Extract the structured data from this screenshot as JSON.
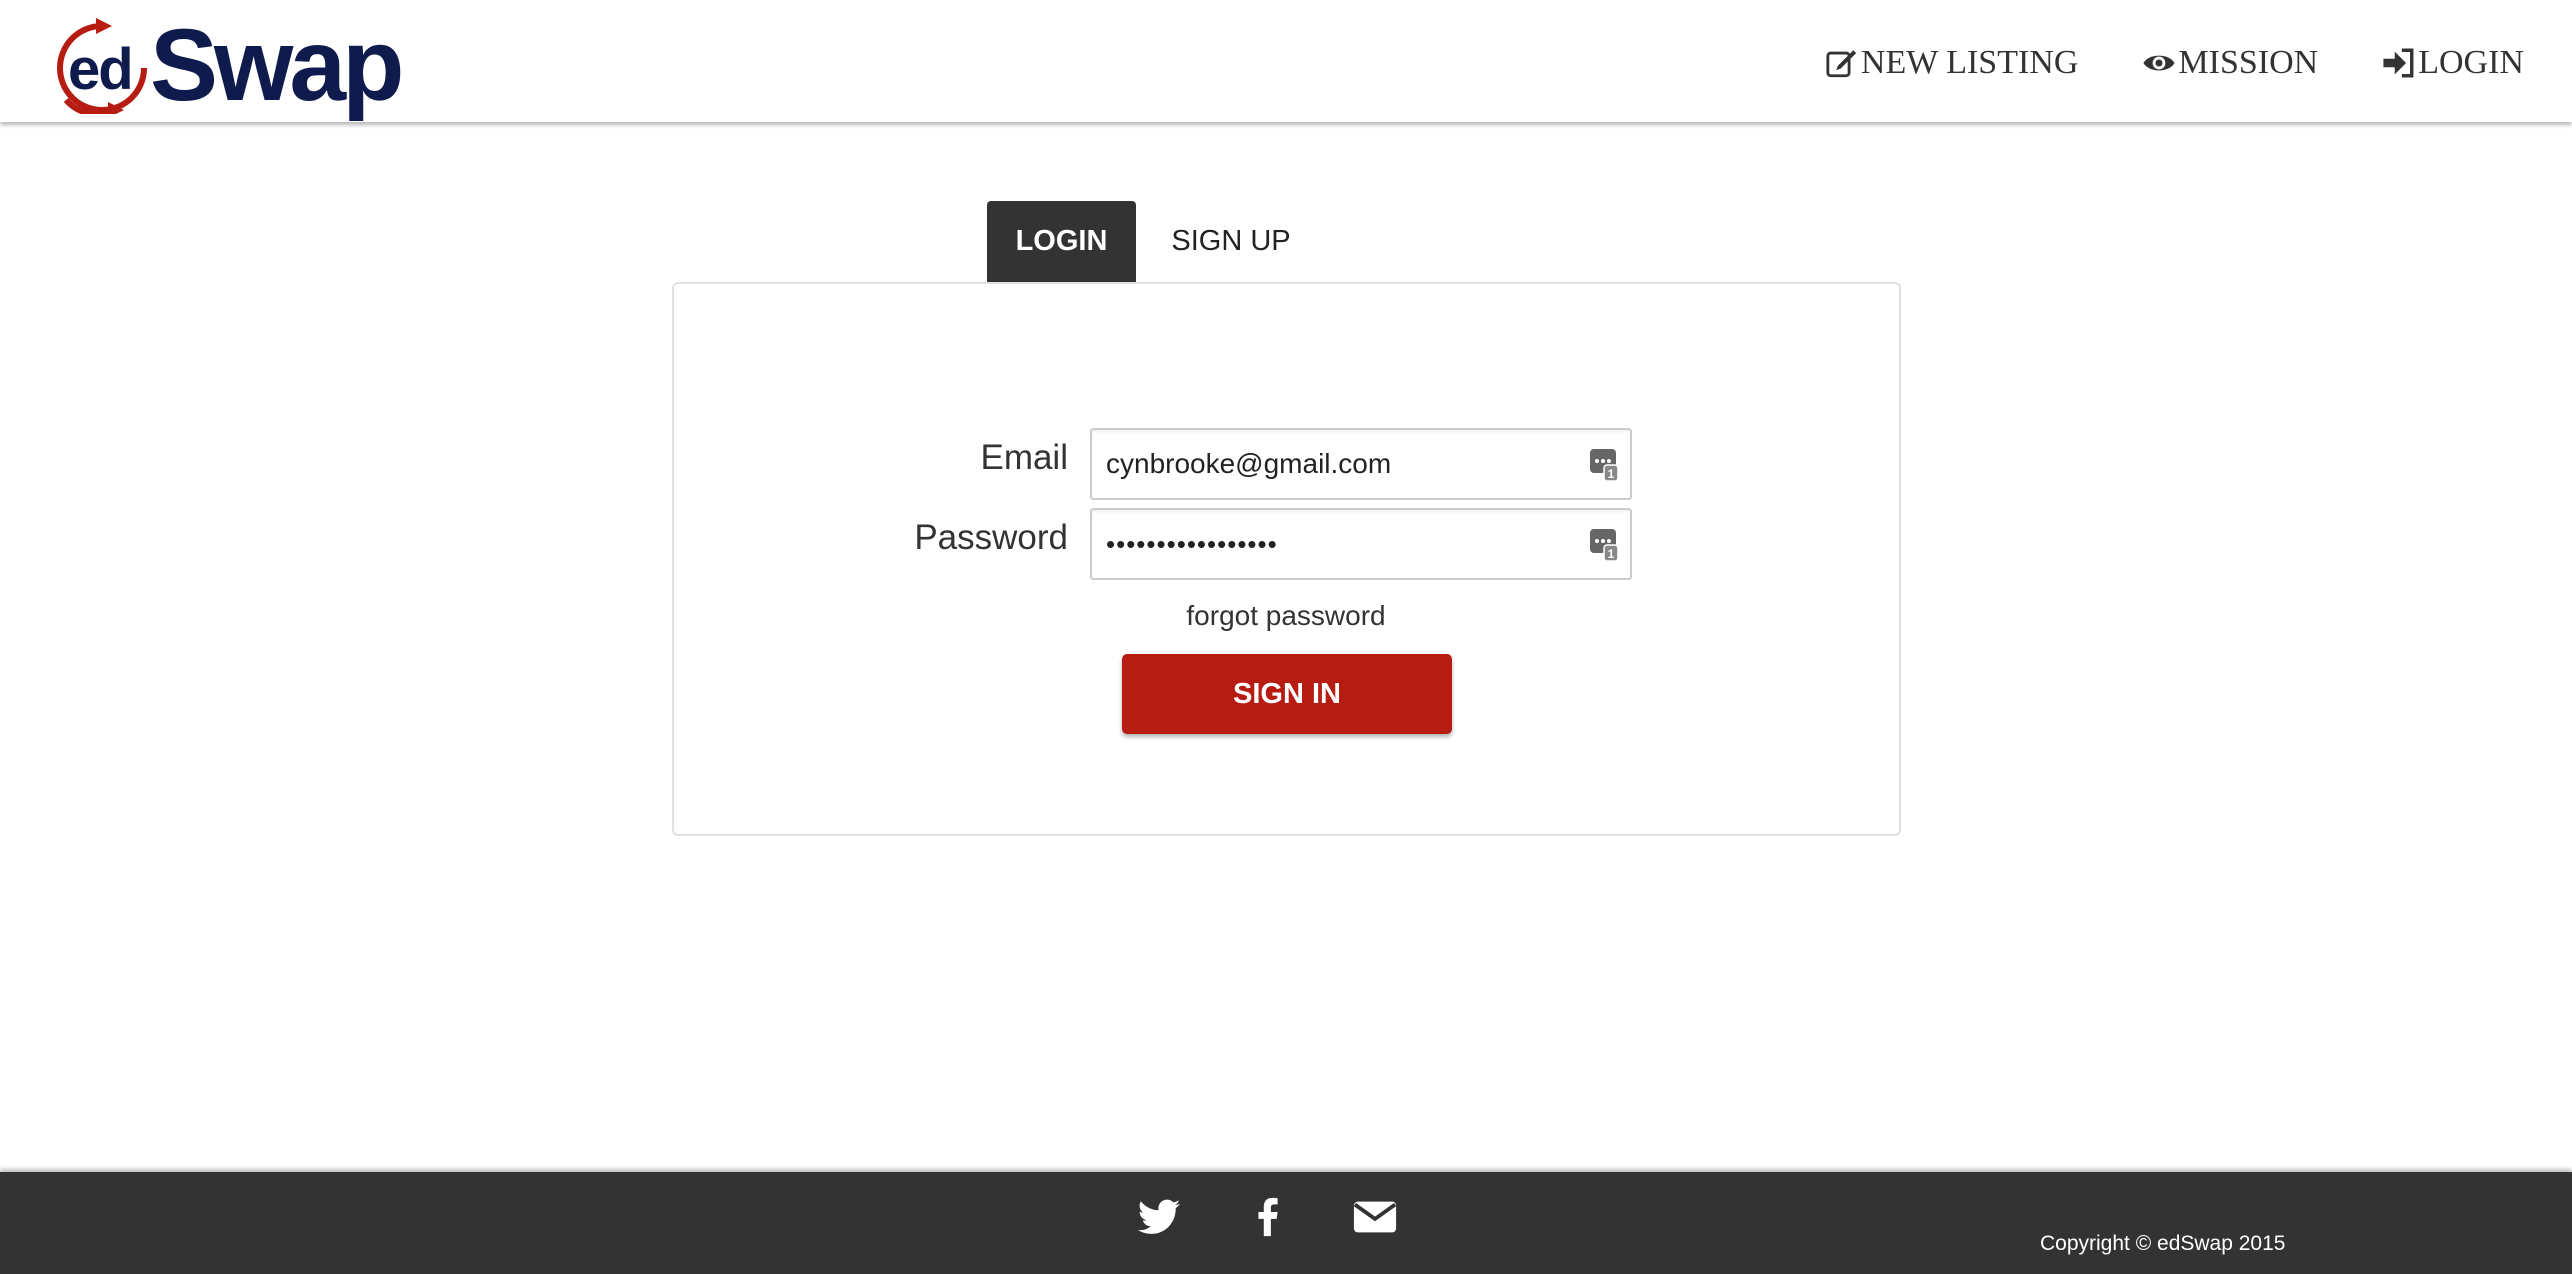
{
  "brand": {
    "logo_prefix": "ed",
    "logo_name": "Swap",
    "colors": {
      "navy": "#0f1a4d",
      "red": "#b71c13",
      "dark": "#333333"
    }
  },
  "nav": {
    "items": [
      {
        "label": "NEW LISTING",
        "icon": "edit-icon"
      },
      {
        "label": "MISSION",
        "icon": "eye-icon"
      },
      {
        "label": "LOGIN",
        "icon": "sign-in-icon"
      }
    ]
  },
  "tabs": {
    "login": "LOGIN",
    "signup": "SIGN UP",
    "active": "LOGIN"
  },
  "form": {
    "email_label": "Email",
    "email_value": "cynbrooke@gmail.com",
    "password_label": "Password",
    "password_value": "•••••••••••••••••",
    "forgot_label": "forgot password",
    "submit_label": "SIGN IN",
    "field_icon": "password-manager-icon"
  },
  "footer": {
    "social": [
      "twitter-icon",
      "facebook-icon",
      "envelope-icon"
    ],
    "copyright": "Copyright © edSwap 2015"
  }
}
